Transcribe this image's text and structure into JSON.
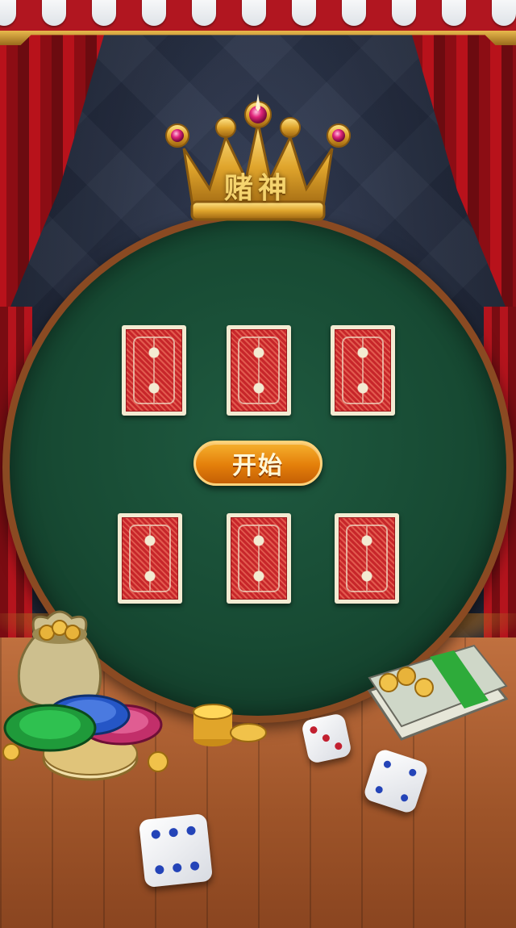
{
  "game": {
    "title": "赌神",
    "start_label": "开始"
  },
  "cards": [
    {
      "row": 1,
      "slot": 1,
      "face": "back"
    },
    {
      "row": 1,
      "slot": 2,
      "face": "back"
    },
    {
      "row": 1,
      "slot": 3,
      "face": "back"
    },
    {
      "row": 2,
      "slot": 1,
      "face": "back"
    },
    {
      "row": 2,
      "slot": 2,
      "face": "back"
    },
    {
      "row": 2,
      "slot": 3,
      "face": "back"
    }
  ],
  "colors": {
    "felt": "#174a33",
    "curtain": "#b8121b",
    "button": "#e47f0a",
    "gold": "#e8b94c"
  },
  "icons": {
    "crown": "crown-icon",
    "chips": "poker-chips-icon",
    "money": "cash-stack-icon",
    "coins": "gold-coins-icon",
    "bag": "money-bag-icon",
    "dice": "dice-icon"
  }
}
